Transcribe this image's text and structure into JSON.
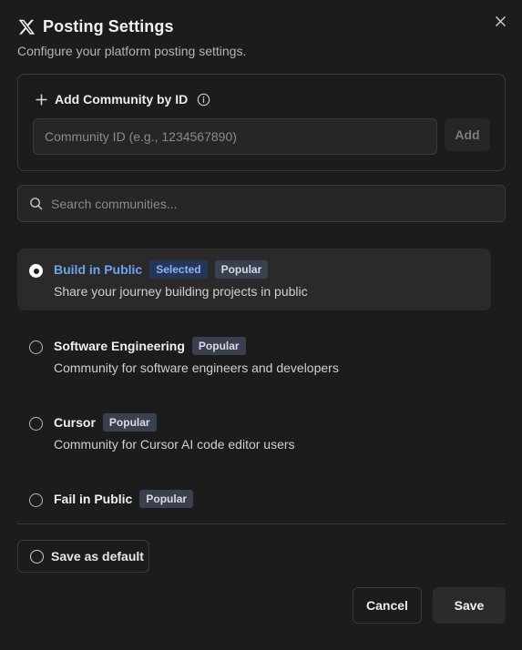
{
  "dialog": {
    "title": "Posting Settings",
    "subtitle": "Configure your platform posting settings.",
    "logo_icon": "x-logo-icon",
    "close_icon": "close-icon"
  },
  "add_community": {
    "heading": "Add Community by ID",
    "input_placeholder": "Community ID (e.g., 1234567890)",
    "input_value": "",
    "add_label": "Add"
  },
  "search": {
    "placeholder": "Search communities...",
    "value": ""
  },
  "communities": [
    {
      "name": "Build in Public",
      "selected": true,
      "selected_badge": "Selected",
      "popular_badge": "Popular",
      "description": "Share your journey building projects in public"
    },
    {
      "name": "Software Engineering",
      "selected": false,
      "popular_badge": "Popular",
      "description": "Community for software engineers and developers"
    },
    {
      "name": "Cursor",
      "selected": false,
      "popular_badge": "Popular",
      "description": "Community for Cursor AI code editor users"
    },
    {
      "name": "Fail in Public",
      "selected": false,
      "popular_badge": "Popular",
      "description": ""
    }
  ],
  "footer": {
    "save_default_label": "Save as default",
    "cancel_label": "Cancel",
    "save_label": "Save"
  },
  "colors": {
    "background": "#1c1c1c",
    "accent_selected": "#6fa3ef",
    "badge_popular": "#3a4050",
    "badge_selected": "#25365a"
  }
}
